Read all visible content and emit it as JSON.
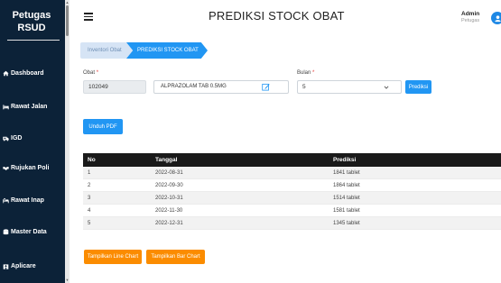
{
  "sidebar": {
    "brand_line1": "Petugas",
    "brand_line2": "RSUD",
    "items": [
      {
        "label": "Dashboard",
        "icon": "home-icon"
      },
      {
        "label": "Rawat Jalan",
        "icon": "bed-icon"
      },
      {
        "label": "IGD",
        "icon": "ambulance-icon"
      },
      {
        "label": "Rujukan Poli",
        "icon": "handshake-icon"
      },
      {
        "label": "Rawat Inap",
        "icon": "procedures-icon"
      },
      {
        "label": "Master Data",
        "icon": "database-icon"
      },
      {
        "label": "Aplicare",
        "icon": "hospital-icon"
      }
    ]
  },
  "header": {
    "title": "PREDIKSI STOCK OBAT",
    "user_name": "Admin",
    "user_role": "Petugas"
  },
  "breadcrumb": {
    "items": [
      "Inventori Obat",
      "PREDIKSI STOCK OBAT"
    ]
  },
  "form": {
    "obat_label": "Obat",
    "obat_code": "102049",
    "obat_name": "ALPRAZOLAM TAB 0.5MG",
    "bulan_label": "Bulan",
    "bulan_value": "5",
    "required_mark": "*",
    "prediksi_button": "Prediksi",
    "unduh_button": "Unduh PDF"
  },
  "table": {
    "columns": [
      "No",
      "Tanggal",
      "Prediksi"
    ],
    "rows": [
      [
        "1",
        "2022-08-31",
        "1841 tablet"
      ],
      [
        "2",
        "2022-09-30",
        "1864 tablet"
      ],
      [
        "3",
        "2022-10-31",
        "1514 tablet"
      ],
      [
        "4",
        "2022-11-30",
        "1581 tablet"
      ],
      [
        "5",
        "2022-12-31",
        "1345 tablet"
      ]
    ]
  },
  "chart_buttons": {
    "line": "Tampilkan Line Chart",
    "bar": "Tampilkan Bar Chart"
  },
  "colors": {
    "sidebar_bg": "#0c2238",
    "primary": "#2196f3",
    "orange": "#fb8c00",
    "table_header": "#1a1a1a"
  }
}
